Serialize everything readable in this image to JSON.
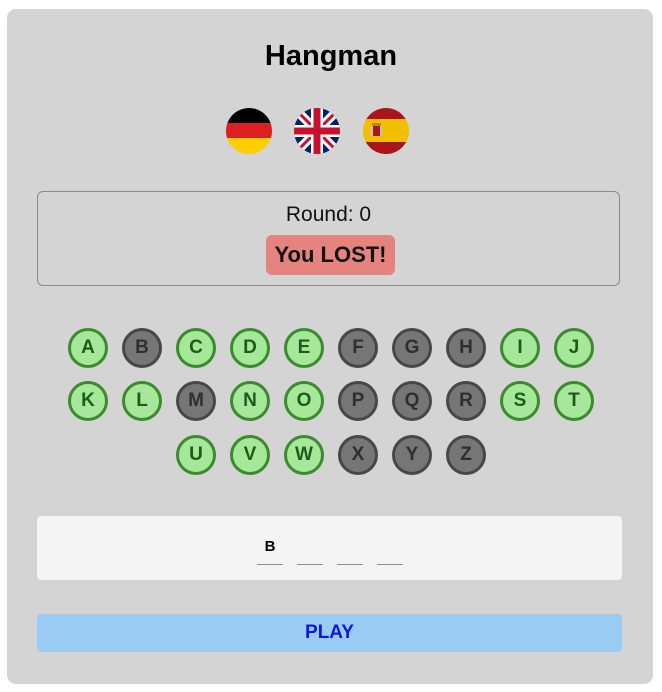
{
  "title": "Hangman",
  "languages": [
    {
      "code": "de",
      "icon": "germany-flag-icon"
    },
    {
      "code": "en",
      "icon": "uk-flag-icon"
    },
    {
      "code": "es",
      "icon": "spain-flag-icon"
    }
  ],
  "round_label": "Round: 0",
  "result_text": "You LOST!",
  "keyboard": {
    "letters": [
      "A",
      "B",
      "C",
      "D",
      "E",
      "F",
      "G",
      "H",
      "I",
      "J",
      "K",
      "L",
      "M",
      "N",
      "O",
      "P",
      "Q",
      "R",
      "S",
      "T",
      "U",
      "V",
      "W",
      "X",
      "Y",
      "Z"
    ],
    "used": [
      "B",
      "F",
      "G",
      "H",
      "M",
      "P",
      "Q",
      "R",
      "X",
      "Y",
      "Z"
    ]
  },
  "word": {
    "slots": [
      "B",
      "",
      "",
      ""
    ]
  },
  "play_label": "PLAY",
  "colors": {
    "panel": "#d4d4d4",
    "key_available": "#a5e89a",
    "key_used": "#767676",
    "result_bg": "#e5837f",
    "play_bg": "#99cbf3",
    "play_text": "#1016e0"
  }
}
